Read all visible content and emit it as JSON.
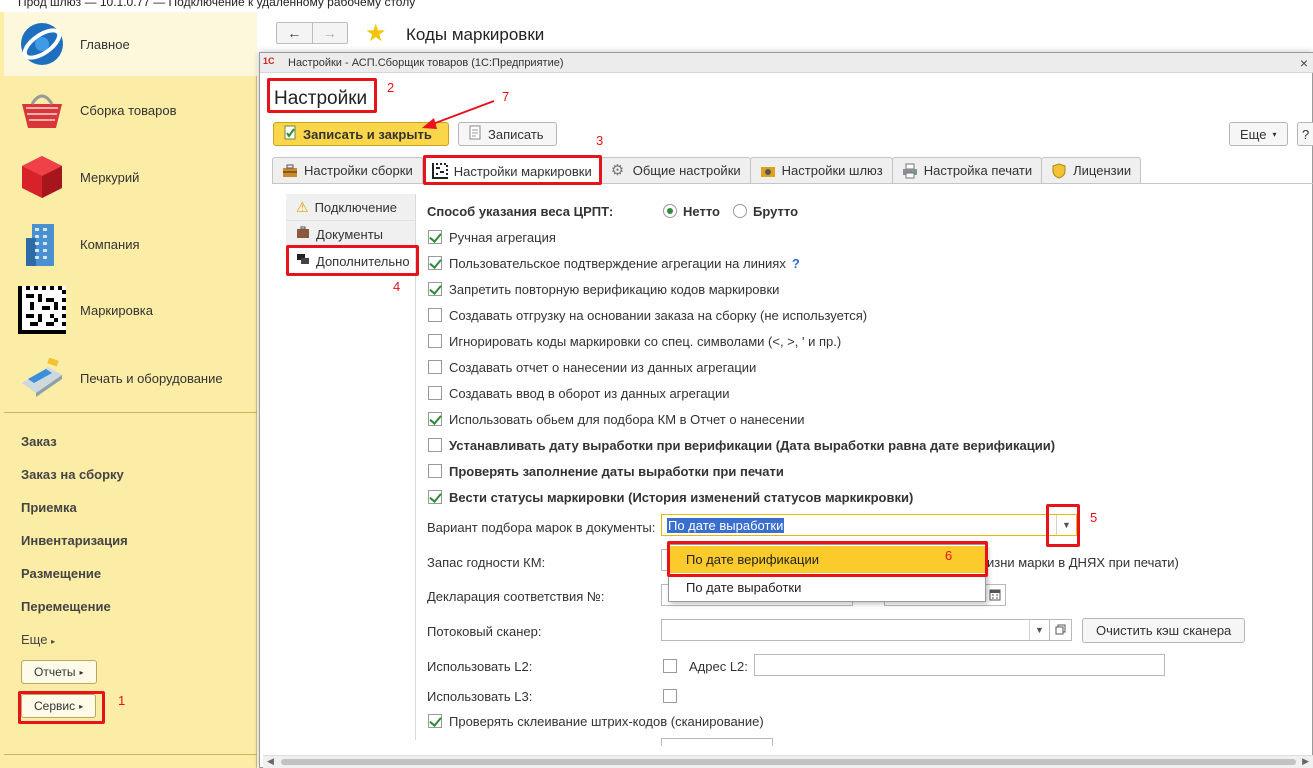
{
  "window": {
    "title": "Прод шлюз — 10.1.0.77 — Подключение к удаленному рабочему столу"
  },
  "sidebar": {
    "sections": [
      {
        "label": "Главное",
        "icon": "home-logo-icon"
      },
      {
        "label": "Сборка товаров",
        "icon": "basket-icon"
      },
      {
        "label": "Меркурий",
        "icon": "red-cube-icon"
      },
      {
        "label": "Компания",
        "icon": "building-icon"
      },
      {
        "label": "Маркировка",
        "icon": "datamatrix-icon"
      },
      {
        "label": "Печать и оборудование",
        "icon": "card-terminal-icon"
      }
    ],
    "links": [
      "Заказ",
      "Заказ на сборку",
      "Приемка",
      "Инвентаризация",
      "Размещение",
      "Перемещение"
    ],
    "more_label": "Еще",
    "reports_label": "Отчеты",
    "service_label": "Сервис"
  },
  "header": {
    "back": "←",
    "forward": "→",
    "title": "Коды маркировки"
  },
  "dialog": {
    "title": "Настройки - АСП.Сборщик товаров (1С:Предприятие)",
    "logo": "1С",
    "form_title": "Настройки",
    "buttons": {
      "save_close": "Записать и закрыть",
      "save": "Записать",
      "more": "Еще",
      "help": "?"
    },
    "tabs": [
      "Настройки сборки",
      "Настройки маркировки",
      "Общие настройки",
      "Настройки шлюз",
      "Настройка печати",
      "Лицензии"
    ],
    "subnav": [
      "Подключение",
      "Документы",
      "Дополнительно"
    ],
    "weight": {
      "label": "Способ указания веса ЦРПТ:",
      "options": [
        "Нетто",
        "Брутто"
      ],
      "selected": "Нетто"
    },
    "checkboxes": [
      {
        "label": "Ручная агрегация",
        "checked": true,
        "bold": false
      },
      {
        "label": "Пользовательское подтверждение агрегации на линиях",
        "checked": true,
        "bold": false,
        "help": "?"
      },
      {
        "label": "Запретить повторную верификацию кодов маркировки",
        "checked": true,
        "bold": false
      },
      {
        "label": "Создавать отгрузку на основании заказа на сборку (не используется)",
        "checked": false,
        "bold": false
      },
      {
        "label": "Игнорировать коды маркировки со спец. символами (<, >, ' и пр.)",
        "checked": false,
        "bold": false
      },
      {
        "label": "Создавать отчет о нанесении из данных агрегации",
        "checked": false,
        "bold": false
      },
      {
        "label": "Создавать ввод в оборот из данных агрегации",
        "checked": false,
        "bold": false
      },
      {
        "label": "Использовать обьем для подбора КМ в Отчет о нанесении",
        "checked": true,
        "bold": false
      },
      {
        "label": "Устанавливать дату выработки при верификации (Дата выработки равна дате верификации)",
        "checked": false,
        "bold": true
      },
      {
        "label": "Проверять заполнение даты выработки при печати",
        "checked": false,
        "bold": true
      },
      {
        "label": "Вести статусы маркировки (История изменений статусов маркикровки)",
        "checked": true,
        "bold": true
      }
    ],
    "variant": {
      "label": "Вариант подбора марок в документы:",
      "value": "По дате выработки"
    },
    "popup_options": [
      "По дате верификации",
      "По дате выработки"
    ],
    "shelf": {
      "label": "Запас годности КМ:",
      "suffix": "изни марки в ДНЯХ при печати)"
    },
    "declaration": {
      "label": "Декларация соответствия №:"
    },
    "scanner": {
      "label": "Потоковый сканер:",
      "clear_button": "Очистить кэш сканера"
    },
    "l2": {
      "label": "Использовать L2:",
      "address_label": "Адрес L2:"
    },
    "l3": {
      "label": "Использовать L3:"
    },
    "barcode_check": {
      "label": "Проверять склеивание штрих-кодов (сканирование)",
      "checked": true
    }
  },
  "annotations": [
    "1",
    "2",
    "3",
    "4",
    "5",
    "6",
    "7"
  ],
  "colors": {
    "accent_yellow": "#fbd64a",
    "highlight": "#fbcb2b",
    "annotation_red": "#e8121a",
    "check_green": "#2e8b3a",
    "sidebar_bg": "#fbeca6"
  }
}
